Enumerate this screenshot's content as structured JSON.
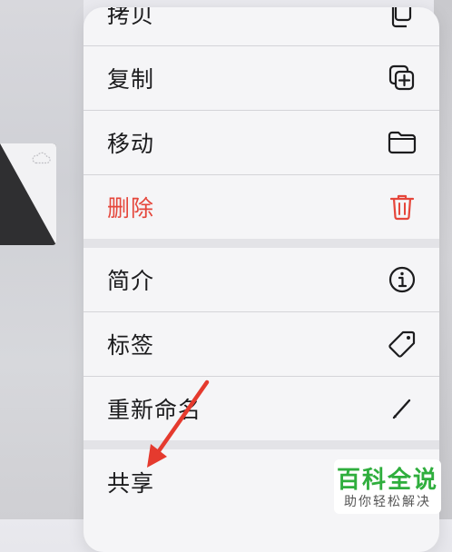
{
  "menu": {
    "items": [
      {
        "label": "拷贝",
        "icon": "copy-icon"
      },
      {
        "label": "复制",
        "icon": "duplicate-icon"
      },
      {
        "label": "移动",
        "icon": "folder-icon"
      },
      {
        "label": "删除",
        "icon": "trash-icon",
        "color": "#e5463b"
      },
      {
        "label": "简介",
        "icon": "info-icon"
      },
      {
        "label": "标签",
        "icon": "tag-icon"
      },
      {
        "label": "重新命名",
        "icon": "pencil-icon"
      },
      {
        "label": "共享",
        "icon": "share-icon"
      }
    ]
  },
  "annotation": {
    "arrow_color": "#e53a2e"
  },
  "watermark": {
    "line1": "百科全说",
    "line2": "助你轻松解决"
  }
}
